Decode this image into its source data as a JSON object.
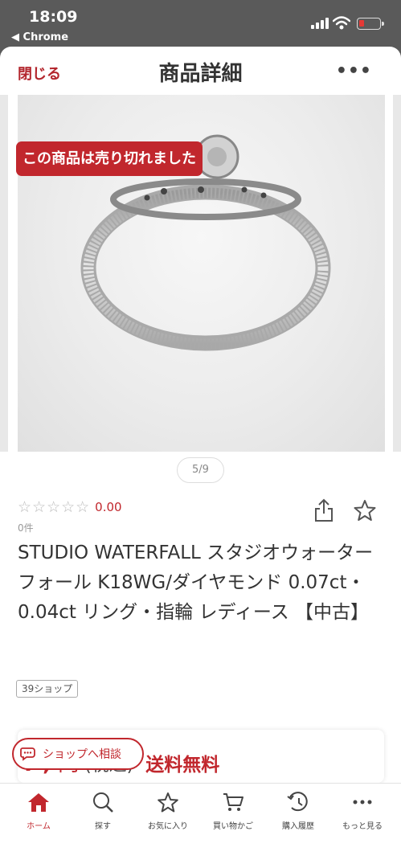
{
  "status_bar": {
    "time": "18:09",
    "back_label": "◀ Chrome"
  },
  "header": {
    "close_label": "閉じる",
    "title": "商品詳細",
    "more_label": "•••"
  },
  "gallery": {
    "soldout_label": "この商品は売り切れました",
    "pager": "5/9"
  },
  "rating": {
    "stars": "☆☆☆☆☆",
    "score": "0.00",
    "review_count": "0件"
  },
  "product": {
    "title": "STUDIO WATERFALL スタジオウォーターフォール K18WG/ダイヤモンド 0.07ct・0.04ct リング・指輪 レディース 【中古】",
    "shop_badge": "39ショップ"
  },
  "price": {
    "amount_partial": "¥ ,   ",
    "yen": "円",
    "tax": "(税込)",
    "shipping": "送料無料"
  },
  "consult": {
    "label": "ショップへ相談"
  },
  "tabbar": {
    "items": [
      {
        "label": "ホーム",
        "icon": "home-icon",
        "active": true
      },
      {
        "label": "探す",
        "icon": "search-icon"
      },
      {
        "label": "お気に入り",
        "icon": "star-icon"
      },
      {
        "label": "買い物かご",
        "icon": "cart-icon"
      },
      {
        "label": "購入履歴",
        "icon": "history-icon"
      },
      {
        "label": "もっと見る",
        "icon": "more-icon"
      }
    ]
  },
  "colors": {
    "accent": "#c1272d",
    "status_bg": "#5a5a5a"
  }
}
